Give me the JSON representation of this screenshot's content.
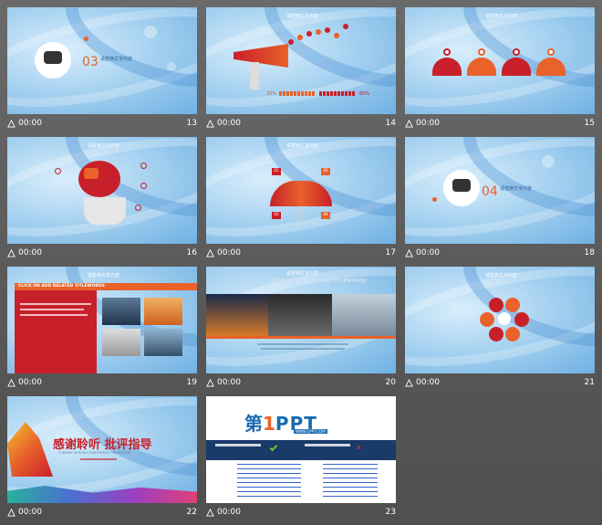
{
  "slides": [
    {
      "number": "13",
      "time": "00:00",
      "section": "03",
      "title": "请替换文字内容"
    },
    {
      "number": "14",
      "time": "00:00",
      "title": "请替换文字内容",
      "left_pct": "30%",
      "right_pct": "60%"
    },
    {
      "number": "15",
      "time": "00:00",
      "title": "请替换文字内容"
    },
    {
      "number": "16",
      "time": "00:00",
      "title": "请替换文字内容"
    },
    {
      "number": "17",
      "time": "00:00",
      "title": "请替换文字内容",
      "labels": [
        "01",
        "02",
        "03",
        "04"
      ]
    },
    {
      "number": "18",
      "time": "00:00",
      "section": "04",
      "title": "请替换文字内容"
    },
    {
      "number": "19",
      "time": "00:00",
      "title": "请替换文字内容",
      "banner": "CLICK ON ADD RELATED TITLEWORDS"
    },
    {
      "number": "20",
      "time": "00:00",
      "title": "请替换文字内容",
      "banner": "CLICK ON ADD RELATED TITLEWORDS"
    },
    {
      "number": "21",
      "time": "00:00",
      "title": "请替换文字内容"
    },
    {
      "number": "22",
      "time": "00:00",
      "headline": "感谢聆听 批评指导",
      "subline": "COMPANY INTRODUCTION PRODUCT PROMOTION"
    },
    {
      "number": "23",
      "time": "00:00",
      "logo_prefix": "第",
      "logo_one": "1",
      "logo_suffix": "PPT",
      "url": "WWW.1PPT.COM"
    }
  ],
  "colors": {
    "accent": "#e8622a",
    "red": "#c8202a",
    "blue": "#6fb1e3"
  },
  "icons": {
    "animation": "star-animation-icon"
  }
}
